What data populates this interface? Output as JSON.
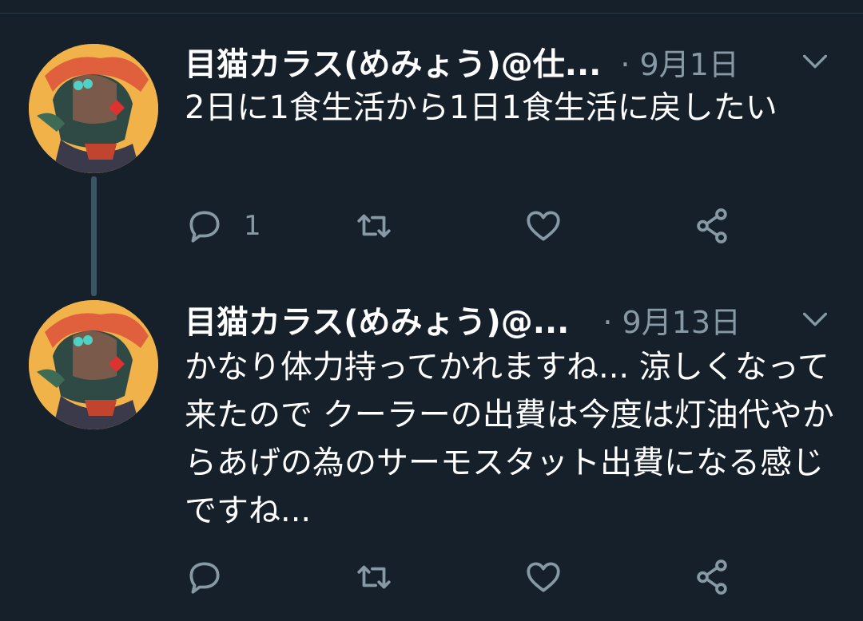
{
  "colors": {
    "background": "#15202b",
    "text": "#ffffff",
    "muted": "#8899a6",
    "thread_line": "#3d5466"
  },
  "tweets": [
    {
      "display_name": "目猫カラス(めみょう)@仕...",
      "date": "· 9月1日",
      "text": "2日に1食生活から1日1食生活に戻したい",
      "reply_count": "1"
    },
    {
      "display_name": "目猫カラス(めみょう)@...",
      "date": "· 9月13日",
      "text": "かなり体力持ってかれますね... 涼しくなって来たので クーラーの出費は今度は灯油代やからあげの為のサーモスタット出費になる感じですね...",
      "reply_count": ""
    }
  ],
  "icons": {
    "reply": "reply-icon",
    "retweet": "retweet-icon",
    "like": "heart-icon",
    "share": "share-icon",
    "menu": "chevron-down-icon"
  }
}
